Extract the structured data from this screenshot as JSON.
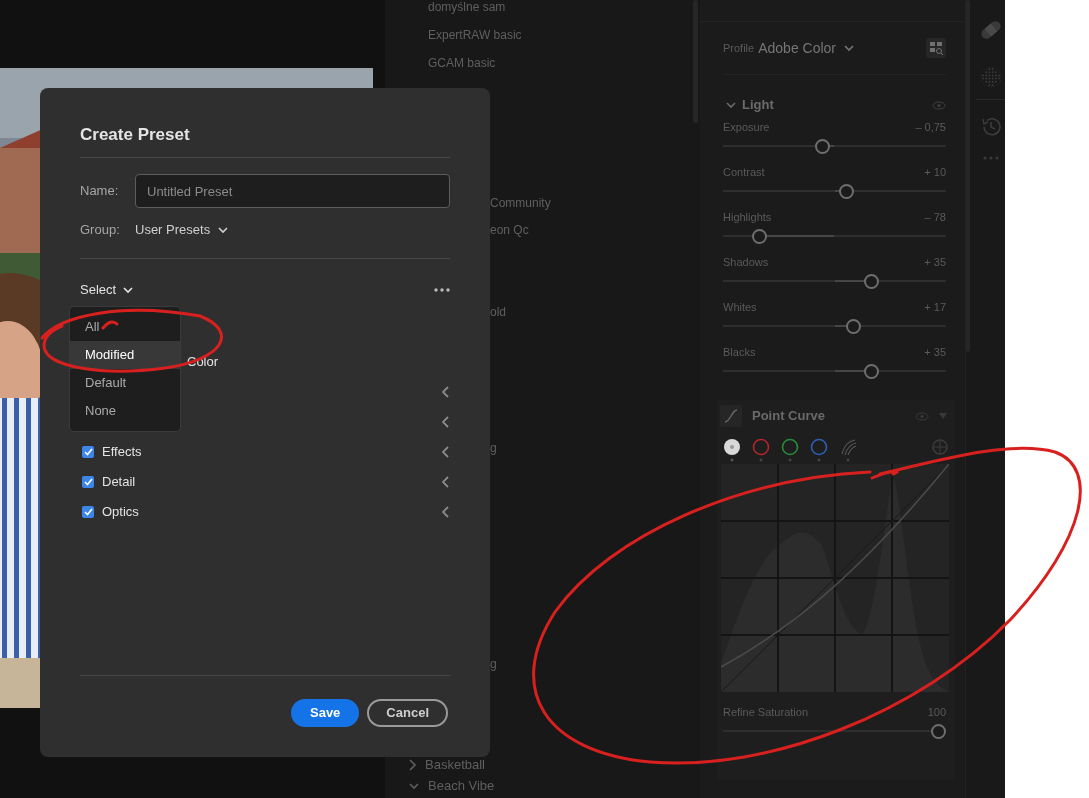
{
  "preset_list": {
    "items": [
      {
        "kind": "entry",
        "label": "domyślne sam"
      },
      {
        "kind": "entry",
        "label": "ExpertRAW basic"
      },
      {
        "kind": "entry",
        "label": "GCAM basic"
      },
      {
        "kind": "fragment",
        "label": "Community"
      },
      {
        "kind": "fragment",
        "label": "eon Qc"
      },
      {
        "kind": "fragment",
        "label": "old"
      },
      {
        "kind": "fragment",
        "label": "g"
      },
      {
        "kind": "fragment",
        "label": "g"
      },
      {
        "kind": "folder",
        "label": "Basketball",
        "expanded": false
      },
      {
        "kind": "folder",
        "label": "Beach Vibe",
        "expanded": true
      }
    ]
  },
  "edit_panel": {
    "profile": {
      "label": "Profile",
      "value": "Adobe Color"
    },
    "light": {
      "title": "Light",
      "expanded": true,
      "sliders": [
        {
          "name": "Exposure",
          "reading": "– 0,75",
          "level": 0.44
        },
        {
          "name": "Contrast",
          "reading": "+ 10",
          "level": 0.56
        },
        {
          "name": "Highlights",
          "reading": "– 78",
          "level": 0.14
        },
        {
          "name": "Shadows",
          "reading": "+ 35",
          "level": 0.68
        },
        {
          "name": "Whites",
          "reading": "+ 17",
          "level": 0.59
        },
        {
          "name": "Blacks",
          "reading": "+ 35",
          "level": 0.68
        }
      ]
    },
    "point_curve": {
      "title": "Point Curve",
      "channels": [
        {
          "color": "#d9d9d9",
          "selected": true
        },
        {
          "color": "#b3262a",
          "selected": false
        },
        {
          "color": "#2a8a3a",
          "selected": false
        },
        {
          "color": "#2d5fb8",
          "selected": false
        }
      ],
      "refine": {
        "name": "Refine Saturation",
        "reading": "100",
        "level": 1
      }
    }
  },
  "dialog": {
    "title": "Create Preset",
    "name_field": {
      "label": "Name:",
      "placeholder": "Untitled Preset"
    },
    "group": {
      "label": "Group:",
      "value": "User Presets"
    },
    "select_label": "Select",
    "settings": [
      {
        "kind": "fragment",
        "label": "Color",
        "expandable": false
      },
      {
        "kind": "hidden",
        "expandable": true
      },
      {
        "kind": "hidden",
        "expandable": true
      },
      {
        "kind": "checkbox",
        "label": "Effects",
        "checked": true,
        "expandable": true
      },
      {
        "kind": "checkbox",
        "label": "Detail",
        "checked": true,
        "expandable": true
      },
      {
        "kind": "checkbox",
        "label": "Optics",
        "checked": true,
        "expandable": true
      }
    ],
    "select_menu": [
      {
        "label": "All",
        "selected": false
      },
      {
        "label": "Modified",
        "selected": true
      },
      {
        "label": "Default",
        "selected": false
      },
      {
        "label": "None",
        "selected": false
      }
    ],
    "buttons": [
      {
        "label": "Save",
        "kind": "primary"
      },
      {
        "label": "Cancel",
        "kind": "secondary"
      }
    ]
  }
}
